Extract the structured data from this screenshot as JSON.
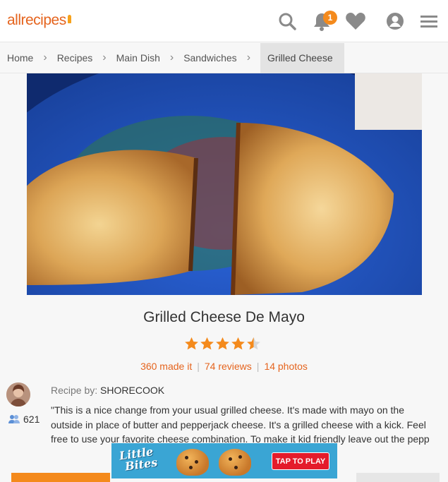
{
  "header": {
    "logo": "allrecipes",
    "notification_count": "1",
    "icons": [
      "search-icon",
      "bell-icon",
      "heart-icon",
      "user-icon",
      "menu-icon"
    ]
  },
  "breadcrumb": {
    "items": [
      "Home",
      "Recipes",
      "Main Dish",
      "Sandwiches"
    ],
    "current": "Grilled Cheese"
  },
  "recipe": {
    "title": "Grilled Cheese De Mayo",
    "rating": 4.5,
    "rating_max": 5,
    "made_it": "360 made it",
    "reviews": "74 reviews",
    "photos": "14 photos",
    "recipe_by_label": "Recipe by:",
    "author": "SHORECOOK",
    "followers": "621",
    "description": "\"This is a nice change from your usual grilled cheese. It's made with mayo on the outside in place of butter and pepperjack cheese. It's a grilled cheese with a kick. Feel free to use your favorite cheese combination. To make it kid friendly leave out the pepp"
  },
  "ad": {
    "brand_line1": "Little",
    "brand_line2": "Bites",
    "cta": "TAP TO PLAY"
  },
  "colors": {
    "accent": "#e5641e",
    "star": "#f48a1c",
    "badge": "#f48a1c",
    "ad_bg": "#3aa5d4",
    "ad_button": "#e41b2b"
  }
}
